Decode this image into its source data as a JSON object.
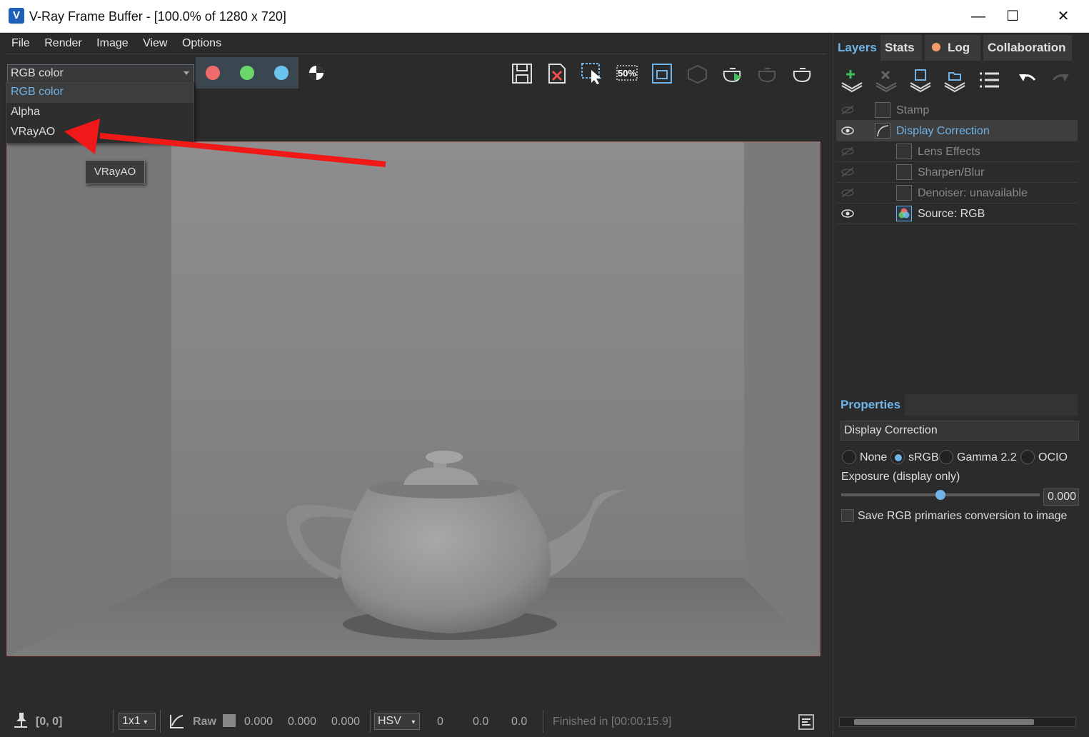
{
  "window": {
    "title": "V-Ray Frame Buffer - [100.0% of 1280 x 720]",
    "logo_letter": "V",
    "minimize": "—",
    "maximize": "☐",
    "close": "✕"
  },
  "menu": [
    "File",
    "Render",
    "Image",
    "View",
    "Options"
  ],
  "toolbar": {
    "channel_selected": "RGB color",
    "channel_buttons": [
      {
        "name": "red-channel",
        "color": "#ef6b6b"
      },
      {
        "name": "green-channel",
        "color": "#6bd66b"
      },
      {
        "name": "blue-channel",
        "color": "#6bc4f0"
      }
    ],
    "zoom_badge": "50%"
  },
  "dropdown": {
    "options": [
      "RGB color",
      "Alpha",
      "VRayAO"
    ],
    "selected_index": 0
  },
  "tooltip": "VRayAO",
  "annotation": {
    "arrow_color": "#f01818"
  },
  "statusbar": {
    "coords": "[0, 0]",
    "sample_size": "1x1",
    "raw_label": "Raw",
    "raw_values": [
      "0.000",
      "0.000",
      "0.000"
    ],
    "color_mode": "HSV",
    "hsv_values": [
      "0",
      "0.0",
      "0.0"
    ],
    "status": "Finished in [00:00:15.9]"
  },
  "side": {
    "tabs": [
      "Layers",
      "Stats",
      "Log",
      "Collaboration"
    ],
    "active_tab": "Layers",
    "log_dot_color": "#f39a6b",
    "layers": [
      {
        "label": "Stamp",
        "visible": false,
        "indent": 0
      },
      {
        "label": "Display Correction",
        "visible": true,
        "indent": 0,
        "selected": true
      },
      {
        "label": "Lens Effects",
        "visible": false,
        "indent": 1
      },
      {
        "label": "Sharpen/Blur",
        "visible": false,
        "indent": 1
      },
      {
        "label": "Denoiser: unavailable",
        "visible": false,
        "indent": 1
      },
      {
        "label": "Source: RGB",
        "visible": true,
        "indent": 1
      }
    ],
    "properties": {
      "title": "Properties",
      "name": "Display Correction",
      "radio_options": [
        "None",
        "sRGB",
        "Gamma 2.2",
        "OCIO"
      ],
      "radio_selected": "sRGB",
      "exposure_label": "Exposure (display only)",
      "exposure_value": "0.000",
      "exposure_level": 0.5,
      "checkbox_label": "Save RGB primaries conversion to image",
      "checkbox_checked": false
    }
  },
  "colors": {
    "accent": "#6fb4e8",
    "background": "#2b2b2b"
  }
}
